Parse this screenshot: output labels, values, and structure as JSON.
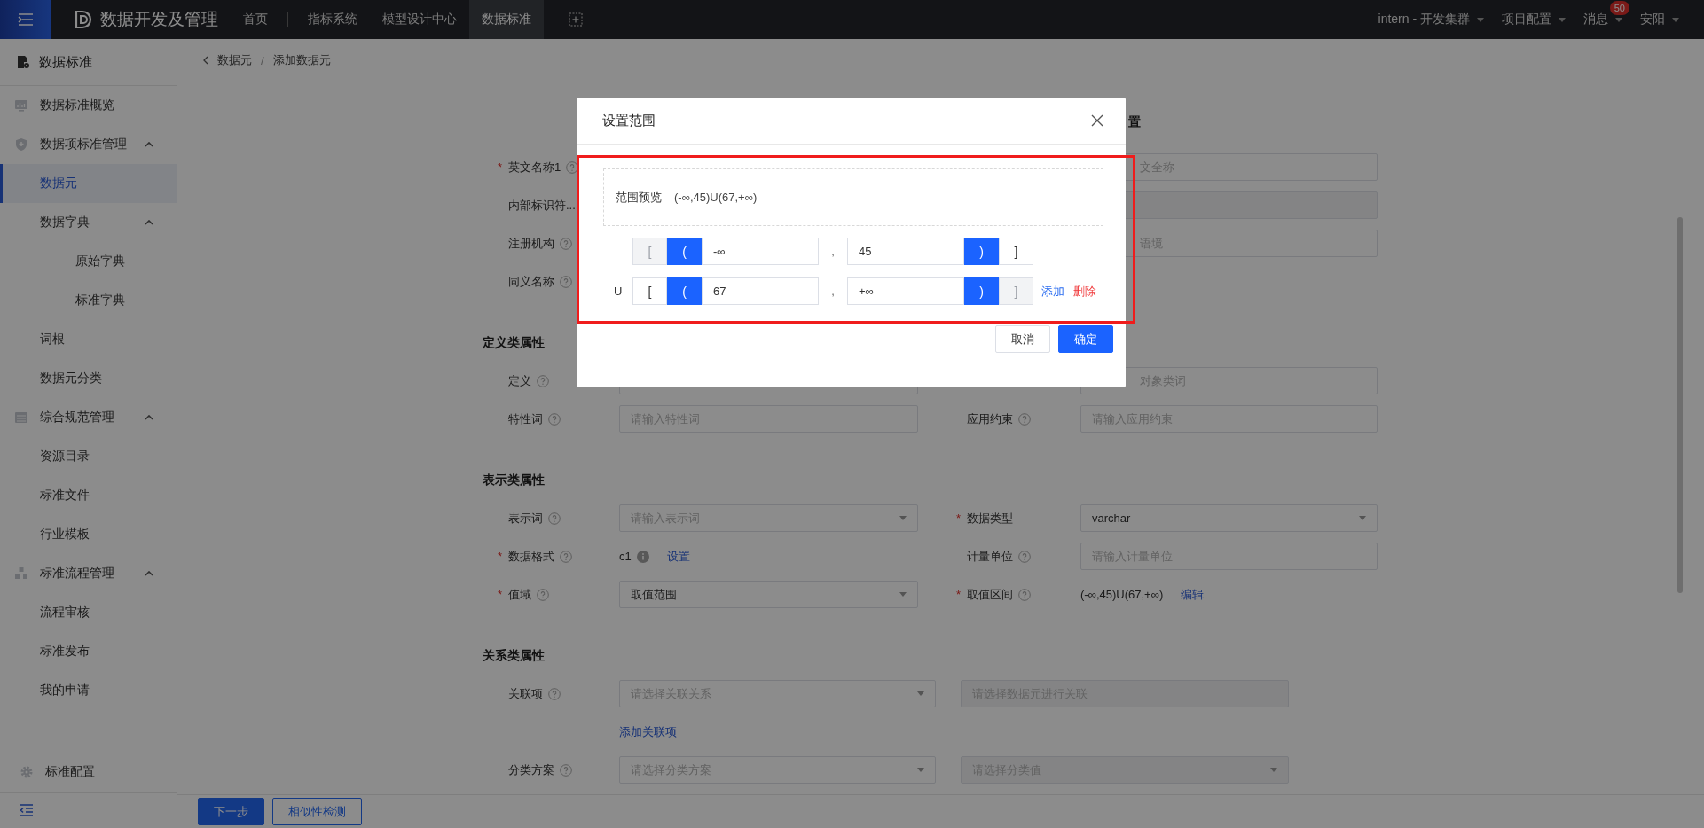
{
  "top_nav": {
    "logo_text": "数据开发及管理",
    "items": [
      {
        "label": "首页",
        "selected": false
      },
      {
        "label": "指标系统",
        "selected": false
      },
      {
        "label": "模型设计中心",
        "selected": false
      },
      {
        "label": "数据标准",
        "selected": true
      }
    ],
    "menus": [
      {
        "label": "intern - 开发集群"
      },
      {
        "label": "项目配置"
      },
      {
        "label": "消息",
        "badge": "50"
      },
      {
        "label": "安阳"
      }
    ]
  },
  "sidebar": {
    "title": "数据标准",
    "items": [
      {
        "label": "数据标准概览",
        "selected": false
      },
      {
        "label": "数据项标准管理",
        "selected": false,
        "expanded": true,
        "children": [
          {
            "label": "数据元",
            "selected": true
          },
          {
            "label": "数据字典",
            "selected": false,
            "expanded": true,
            "children": [
              {
                "label": "原始字典",
                "selected": false
              },
              {
                "label": "标准字典",
                "selected": false
              }
            ]
          },
          {
            "label": "词根",
            "selected": false
          },
          {
            "label": "数据元分类",
            "selected": false
          }
        ]
      },
      {
        "label": "综合规范管理",
        "selected": false,
        "expanded": true,
        "children": [
          {
            "label": "资源目录",
            "selected": false
          },
          {
            "label": "标准文件",
            "selected": false
          },
          {
            "label": "行业模板",
            "selected": false
          }
        ]
      },
      {
        "label": "标准流程管理",
        "selected": false,
        "expanded": true,
        "children": [
          {
            "label": "流程审核",
            "selected": false
          },
          {
            "label": "标准发布",
            "selected": false
          },
          {
            "label": "我的申请",
            "selected": false
          }
        ]
      }
    ],
    "footer_item": {
      "label": "标准配置"
    }
  },
  "breadcrumb": [
    {
      "label": "数据元"
    },
    {
      "separator": "/",
      "label": "添加数据元"
    }
  ],
  "form": {
    "sections": [
      {
        "title": "置",
        "rows": [
          {
            "kind": "pair",
            "left": {
              "label": "英文名称1",
              "required_mark": "*",
              "help": true
            },
            "right": {
              "field": {
                "kind": "input",
                "placeholder": "文全称",
                "partial": true
              }
            }
          },
          {
            "kind": "pair",
            "left": {
              "label": "内部标识符...",
              "help": false
            },
            "right": {
              "field": {
                "kind": "disabled"
              }
            }
          },
          {
            "kind": "pair",
            "left": {
              "label": "注册机构",
              "help": true
            },
            "right": {
              "field": {
                "kind": "input",
                "placeholder": "语境",
                "partial": true
              }
            }
          },
          {
            "kind": "pair",
            "left": {
              "label": "同义名称",
              "help": true
            }
          }
        ]
      },
      {
        "title": "定义类属性",
        "rows": [
          {
            "kind": "pair",
            "left": {
              "label": "定义",
              "help": true,
              "field": {
                "kind": "input"
              }
            },
            "right": {
              "field": {
                "kind": "input",
                "placeholder": "对象类词",
                "partial": true
              }
            }
          },
          {
            "kind": "pair",
            "left": {
              "label": "特性词",
              "help": true,
              "field": {
                "kind": "input",
                "placeholder": "请输入特性词"
              }
            },
            "right": {
              "label": "应用约束",
              "help": true,
              "field": {
                "kind": "input",
                "placeholder": "请输入应用约束"
              }
            }
          }
        ]
      },
      {
        "title": "表示类属性",
        "rows": [
          {
            "kind": "pair",
            "left": {
              "label": "表示词",
              "help": true,
              "field": {
                "kind": "select",
                "placeholder": "请输入表示词"
              }
            },
            "right": {
              "label": "数据类型",
              "required_mark": "*",
              "help": false,
              "field": {
                "kind": "select",
                "value": "varchar"
              }
            }
          },
          {
            "kind": "pair",
            "left": {
              "label": "数据格式",
              "required_mark": "*",
              "help": true,
              "field": {
                "kind": "text",
                "value": "c1",
                "info": true,
                "link": "设置"
              }
            },
            "right": {
              "label": "计量单位",
              "help": true,
              "field": {
                "kind": "input",
                "placeholder": "请输入计量单位"
              }
            }
          },
          {
            "kind": "pair",
            "left": {
              "label": "值域",
              "required_mark": "*",
              "help": true,
              "field": {
                "kind": "select",
                "value": "取值范围"
              }
            },
            "right": {
              "label": "取值区间",
              "required_mark": "*",
              "help": true,
              "field": {
                "kind": "text",
                "value": "(-∞,45)U(67,+∞)",
                "link": "编辑"
              }
            }
          }
        ]
      },
      {
        "title": "关系类属性",
        "rows": [
          {
            "kind": "double",
            "label": "关联项",
            "help": true,
            "fields": [
              {
                "kind": "select",
                "placeholder": "请选择关联关系"
              },
              {
                "kind": "disabled",
                "placeholder": "请选择数据元进行关联"
              }
            ]
          },
          {
            "kind": "link",
            "link": "添加关联项"
          },
          {
            "kind": "double",
            "label": "分类方案",
            "help": true,
            "fields": [
              {
                "kind": "select",
                "placeholder": "请选择分类方案"
              },
              {
                "kind": "disabled-select",
                "placeholder": "请选择分类值"
              }
            ]
          }
        ]
      }
    ]
  },
  "footer_buttons": [
    {
      "label": "下一步",
      "kind": "primary"
    },
    {
      "label": "相似性检测",
      "kind": "outline"
    }
  ],
  "modal": {
    "title": "设置范围",
    "preview_label": "范围预览",
    "preview_value": "(-∞,45)U(67,+∞)",
    "ranges": [
      {
        "lower_brackets": [
          {
            "label": "[",
            "selected": false,
            "disabled": true
          },
          {
            "label": "(",
            "selected": true,
            "disabled": false
          }
        ],
        "lower": "-∞",
        "separator": ",",
        "upper": "45",
        "upper_brackets": [
          {
            "label": ")",
            "selected": true,
            "disabled": false
          },
          {
            "label": "]",
            "selected": false,
            "disabled": false
          }
        ]
      },
      {
        "union": "U",
        "lower_brackets": [
          {
            "label": "[",
            "selected": false,
            "disabled": false
          },
          {
            "label": "(",
            "selected": true,
            "disabled": false
          }
        ],
        "lower": "67",
        "separator": ",",
        "upper": "+∞",
        "upper_brackets": [
          {
            "label": ")",
            "selected": true,
            "disabled": false
          },
          {
            "label": "]",
            "selected": false,
            "disabled": true
          }
        ],
        "actions": [
          {
            "label": "添加",
            "kind": "add"
          },
          {
            "label": "删除",
            "kind": "delete"
          }
        ]
      }
    ],
    "buttons": [
      {
        "label": "取消",
        "kind": "default"
      },
      {
        "label": "确定",
        "kind": "primary"
      }
    ]
  }
}
